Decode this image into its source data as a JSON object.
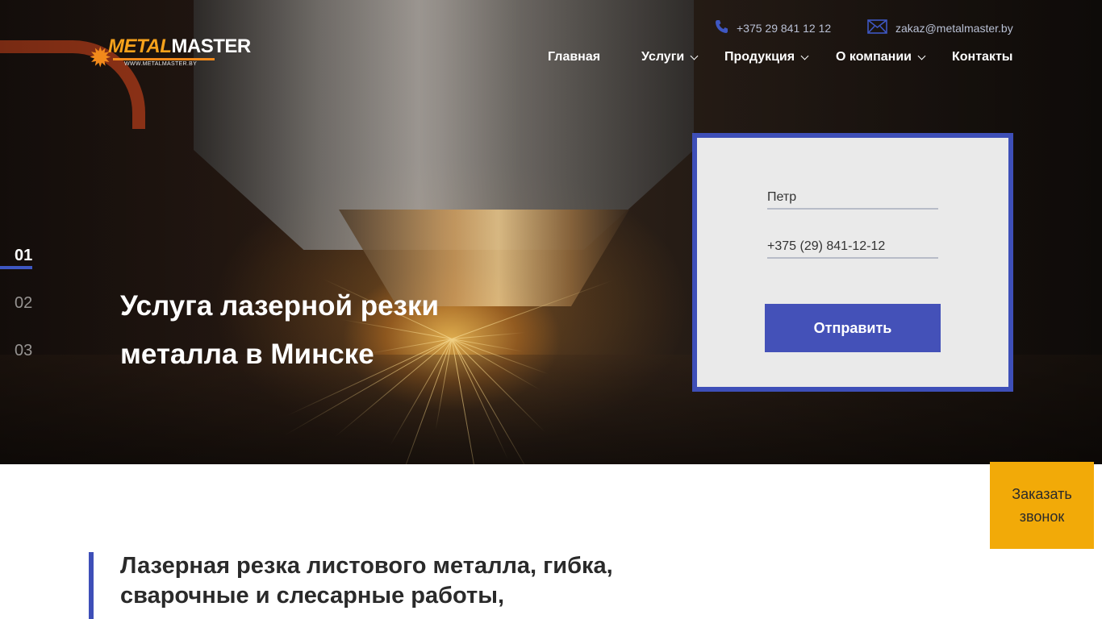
{
  "header": {
    "logo": {
      "brand_part1": "METAL",
      "brand_part2": "MASTER",
      "site": "WWW.METALMASTER.BY"
    },
    "phone": "+375 29 841 12 12",
    "email": "zakaz@metalmaster.by",
    "nav": [
      {
        "label": "Главная",
        "has_dropdown": false
      },
      {
        "label": "Услуги",
        "has_dropdown": true
      },
      {
        "label": "Продукция",
        "has_dropdown": true
      },
      {
        "label": "О компании",
        "has_dropdown": true
      },
      {
        "label": "Контакты",
        "has_dropdown": false
      }
    ]
  },
  "hero": {
    "slides": [
      "01",
      "02",
      "03"
    ],
    "active_slide": "01",
    "title": "Услуга лазерной резки металла в Минске"
  },
  "form": {
    "name_value": "Петр",
    "phone_value": "+375 (29) 841-12-12",
    "submit_label": "Отправить"
  },
  "callback": {
    "label": "Заказать звонок"
  },
  "intro": {
    "title": "Лазерная резка листового металла, гибка, сварочные и слесарные работы,"
  },
  "colors": {
    "accent_blue": "#3e4fb8",
    "callback_yellow": "#f2aa08",
    "logo_orange": "#f28a1b"
  },
  "icons": {
    "phone": "phone-icon",
    "email": "envelope-icon",
    "dropdown": "chevron-down-icon"
  }
}
